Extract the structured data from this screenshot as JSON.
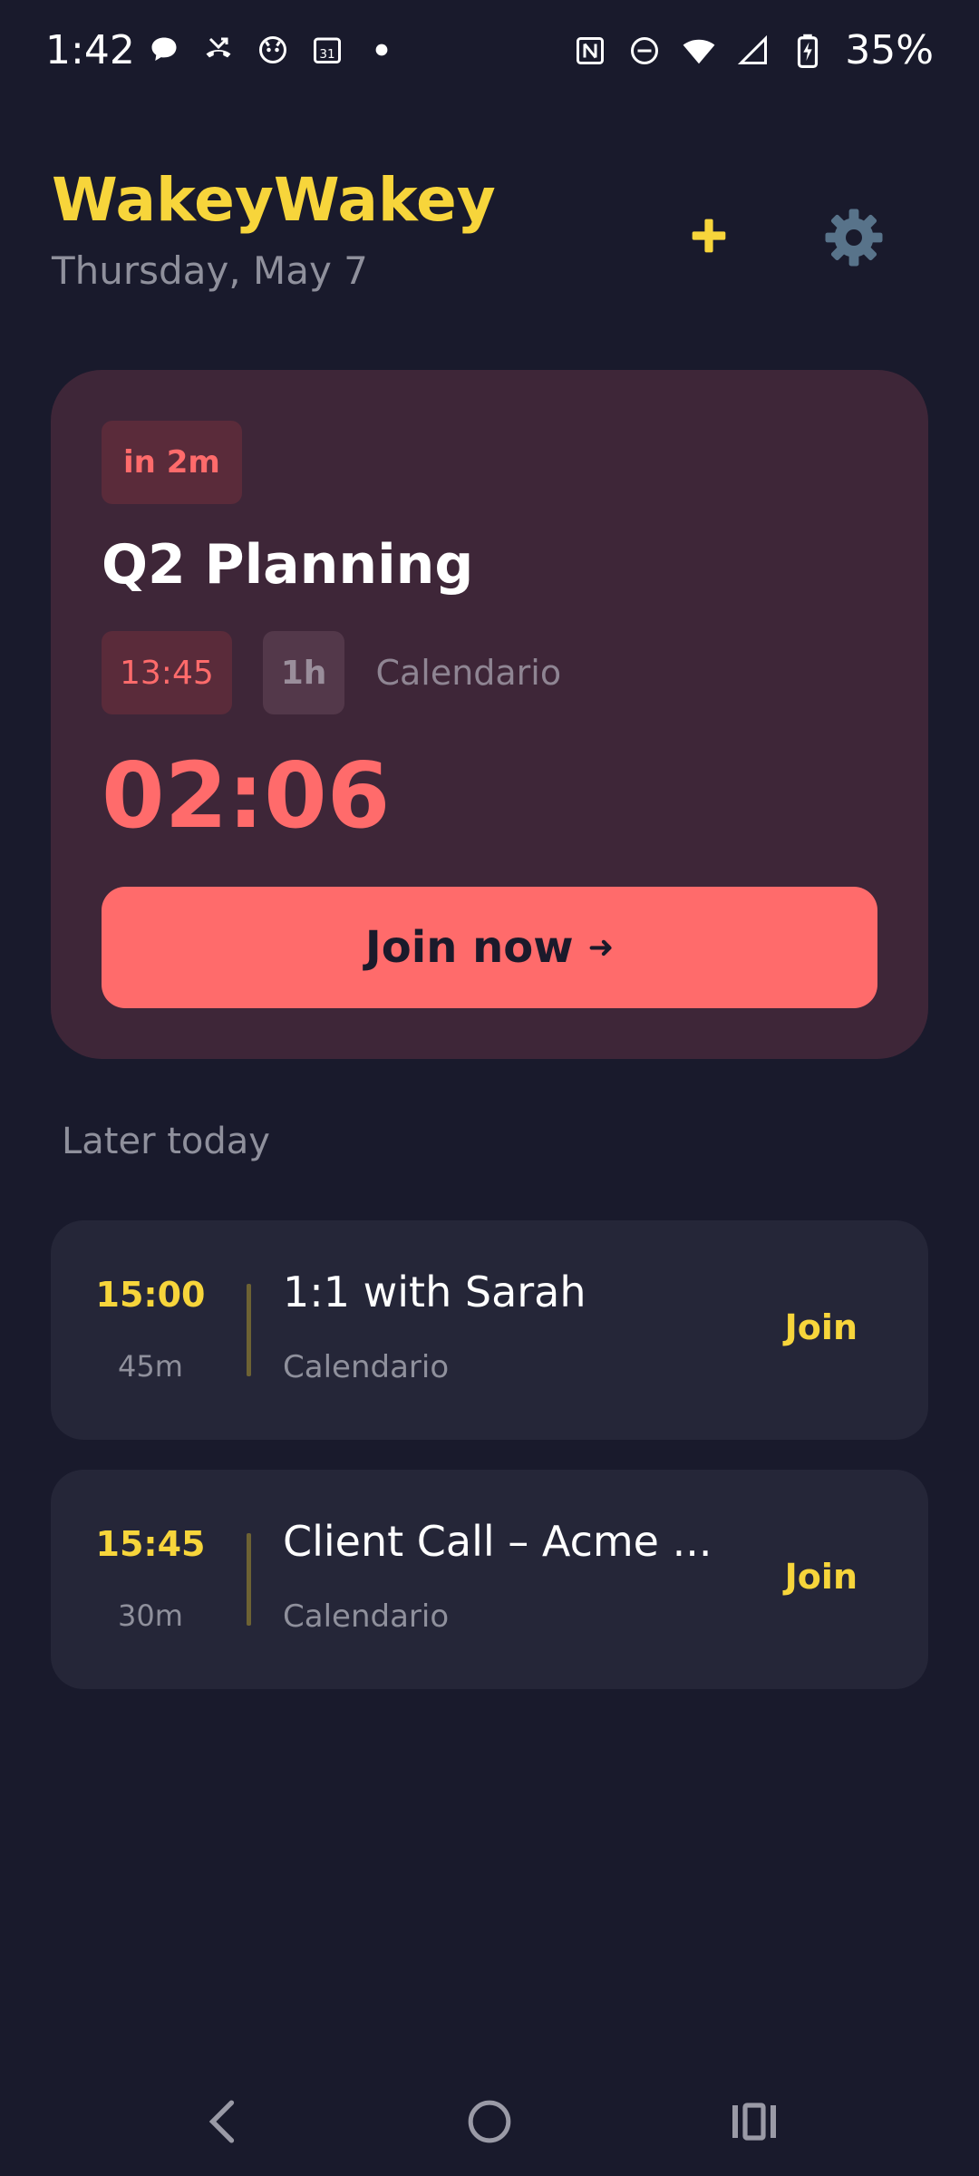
{
  "status_bar": {
    "time": "1:42",
    "battery": "35%"
  },
  "header": {
    "title": "WakeyWakey",
    "date": "Thursday, May 7"
  },
  "next_meeting": {
    "in_label": "in 2m",
    "title": "Q2 Planning",
    "time": "13:45",
    "duration": "1h",
    "source": "Calendario",
    "countdown": "02:06",
    "join_label": "Join now",
    "join_arrow": "➜"
  },
  "later": {
    "title": "Later today",
    "events": [
      {
        "time": "15:00",
        "duration": "45m",
        "title": "1:1 with Sarah",
        "source": "Calendario",
        "join_label": "Join"
      },
      {
        "time": "15:45",
        "duration": "30m",
        "title": "Client Call – Acme ...",
        "source": "Calendario",
        "join_label": "Join"
      }
    ]
  },
  "colors": {
    "accent": "#f7d53b",
    "danger": "#ff6b6b",
    "background": "#191a2c"
  }
}
